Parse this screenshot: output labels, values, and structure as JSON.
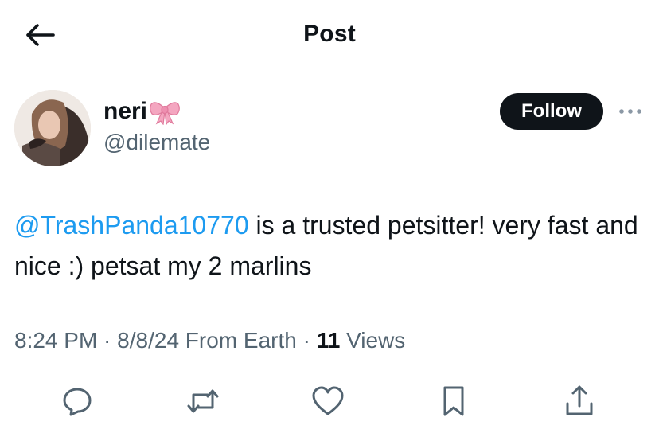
{
  "header": {
    "title": "Post",
    "back_icon": "arrow-left-icon"
  },
  "author": {
    "display_name": "neri",
    "name_emoji_icon": "pink-bow-icon",
    "handle": "@dilemate",
    "follow_label": "Follow",
    "more_icon": "ellipsis-icon"
  },
  "post": {
    "mention": "@TrashPanda10770",
    "text": " is a trusted petsitter! very fast and nice :) petsat my 2 marlins"
  },
  "meta": {
    "time": "8:24 PM",
    "sep1": " · ",
    "date": "8/8/24",
    "location": " From Earth",
    "sep2": " · ",
    "views_count": "11",
    "views_label": " Views"
  },
  "actions": [
    {
      "icon": "reply-icon"
    },
    {
      "icon": "repost-icon"
    },
    {
      "icon": "like-icon"
    },
    {
      "icon": "bookmark-icon"
    },
    {
      "icon": "share-icon"
    }
  ],
  "colors": {
    "text_primary": "#0f1419",
    "text_secondary": "#536471",
    "link": "#1d9bf0",
    "follow_bg": "#0f1419",
    "bow_pink": "#f4a6c0"
  }
}
